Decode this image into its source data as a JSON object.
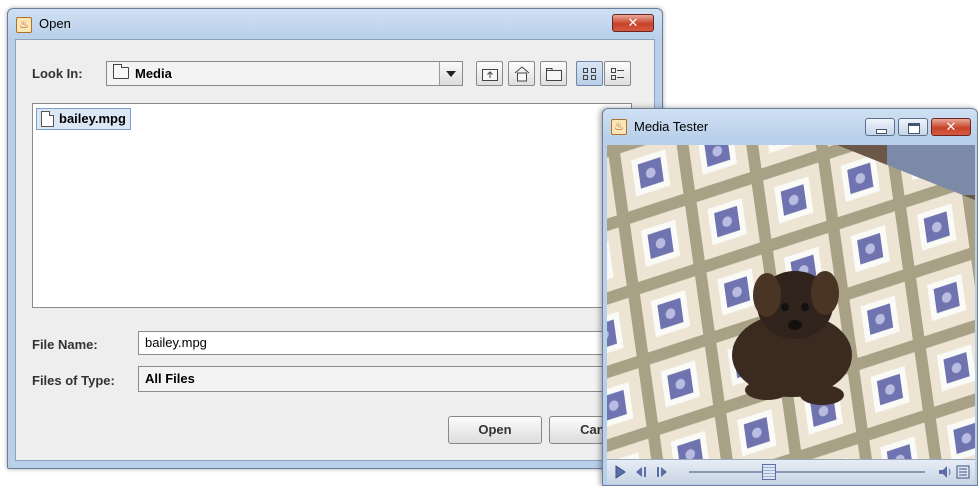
{
  "open_dialog": {
    "title": "Open",
    "close_glyph": "✕",
    "look_in_label": "Look In:",
    "look_in_value": "Media",
    "files": [
      {
        "name": "bailey.mpg",
        "icon": "document-icon"
      }
    ],
    "file_name_label": "File Name:",
    "file_name_value": "bailey.mpg",
    "files_of_type_label": "Files of Type:",
    "files_of_type_value": "All Files",
    "open_button": "Open",
    "cancel_button": "Canc",
    "toolbar_icons": [
      "up-folder-icon",
      "home-icon",
      "new-folder-icon",
      "list-view-icon",
      "details-view-icon"
    ]
  },
  "media_window": {
    "title": "Media Tester",
    "close_glyph": "✕",
    "controls": [
      "play-icon",
      "step-back-icon",
      "step-forward-icon",
      "position-slider",
      "volume-icon",
      "media-info-icon"
    ],
    "slider_position": 0.33
  },
  "colors": {
    "title_bar": "#b9d0ea",
    "close_button": "#c7432a",
    "selection": "#dce7f5"
  }
}
